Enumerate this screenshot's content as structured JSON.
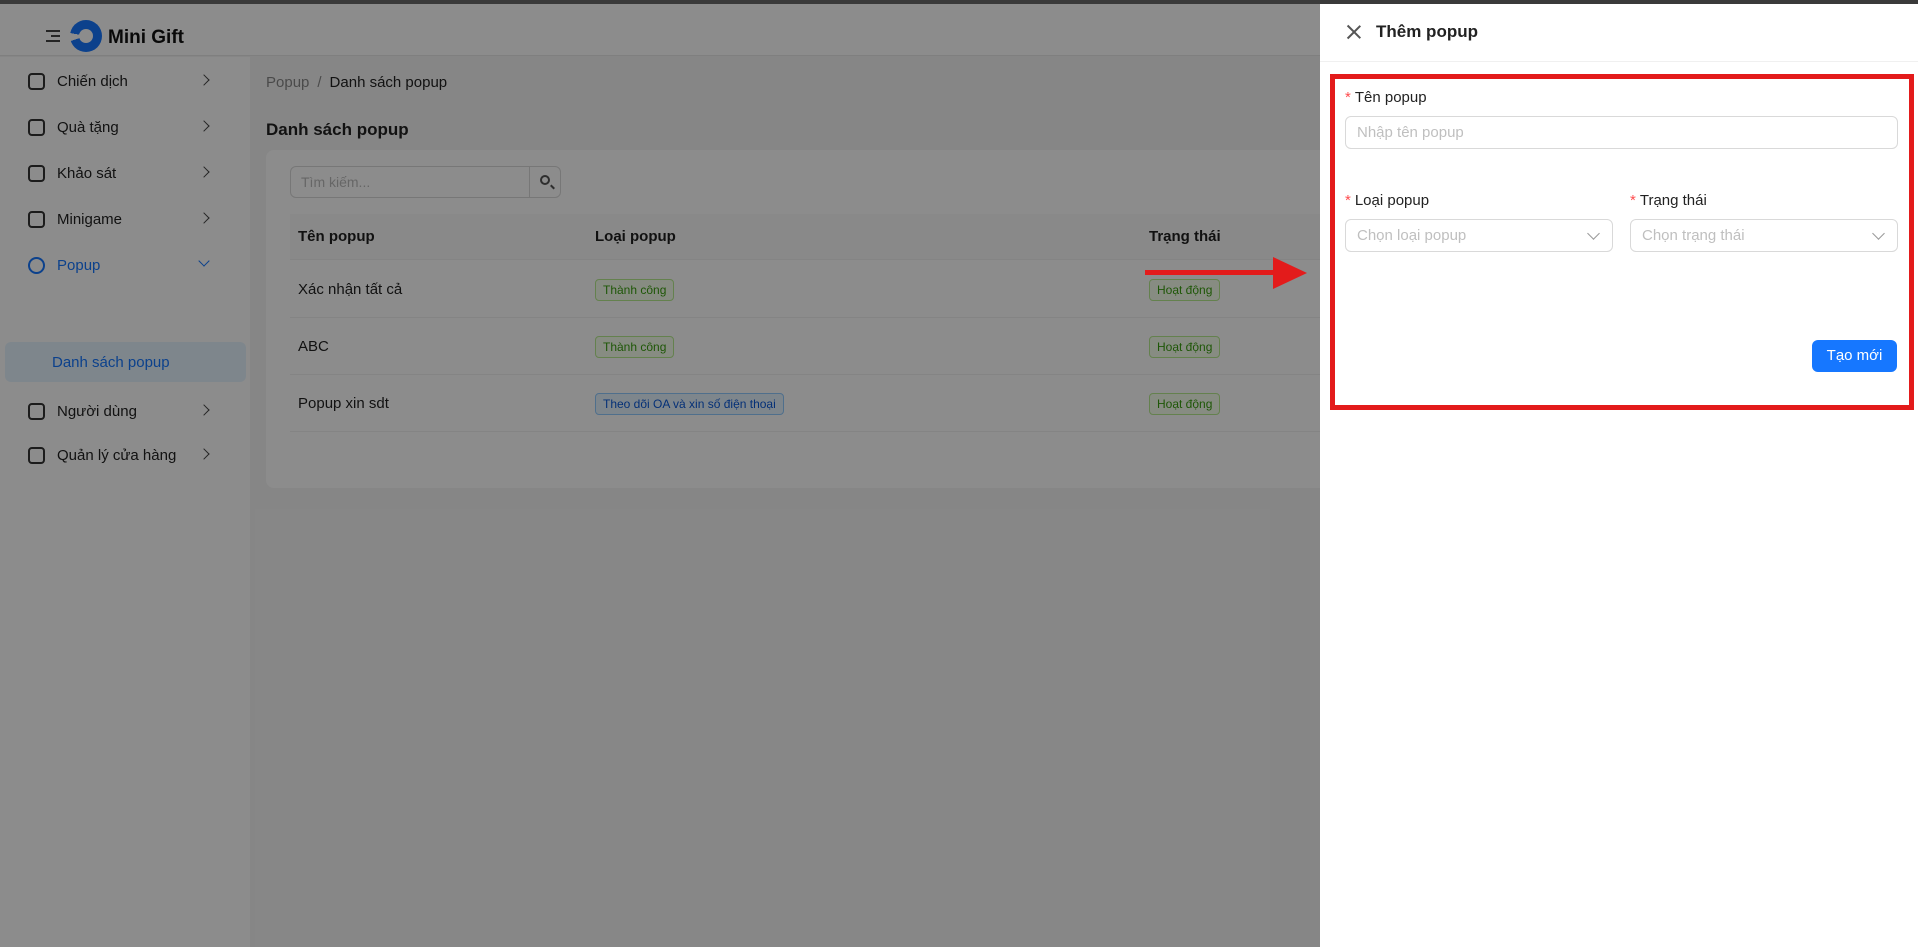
{
  "app": {
    "name": "Mini Gift"
  },
  "sidebar": {
    "items": [
      {
        "label": "Chiến dịch",
        "icon": "campaign-icon"
      },
      {
        "label": "Quà tặng",
        "icon": "gift-icon"
      },
      {
        "label": "Khảo sát",
        "icon": "survey-icon"
      },
      {
        "label": "Minigame",
        "icon": "game-icon"
      },
      {
        "label": "Popup",
        "icon": "popup-icon"
      },
      {
        "label": "Người dùng",
        "icon": "users-icon"
      },
      {
        "label": "Quản lý cửa hàng",
        "icon": "store-icon"
      }
    ],
    "active_sub": "Danh sách popup"
  },
  "breadcrumb": {
    "parent": "Popup",
    "separator": "/",
    "current": "Danh sách popup"
  },
  "page": {
    "title": "Danh sách popup"
  },
  "search": {
    "placeholder": "Tìm kiếm..."
  },
  "table": {
    "headers": [
      "Tên popup",
      "Loại popup",
      "Trạng thái"
    ],
    "rows": [
      {
        "name": "Xác nhận tất cả",
        "type": "Thành công",
        "status": "Hoạt động"
      },
      {
        "name": "ABC",
        "type": "Thành công",
        "status": "Hoạt động"
      },
      {
        "name": "Popup xin sdt",
        "type": "Theo dõi OA và xin số điện thoại",
        "status": "Hoạt động"
      }
    ]
  },
  "drawer": {
    "title": "Thêm popup",
    "fields": {
      "name": {
        "label": "Tên popup",
        "placeholder": "Nhập tên popup",
        "required": "*"
      },
      "type": {
        "label": "Loại popup",
        "placeholder": "Chọn loại popup",
        "required": "*"
      },
      "status": {
        "label": "Trạng thái",
        "placeholder": "Chọn trạng thái",
        "required": "*"
      }
    },
    "submit_label": "Tạo mới"
  },
  "colors": {
    "primary": "#1677ff",
    "annotation": "#e31b1b",
    "success_tag": "#389e0d"
  }
}
